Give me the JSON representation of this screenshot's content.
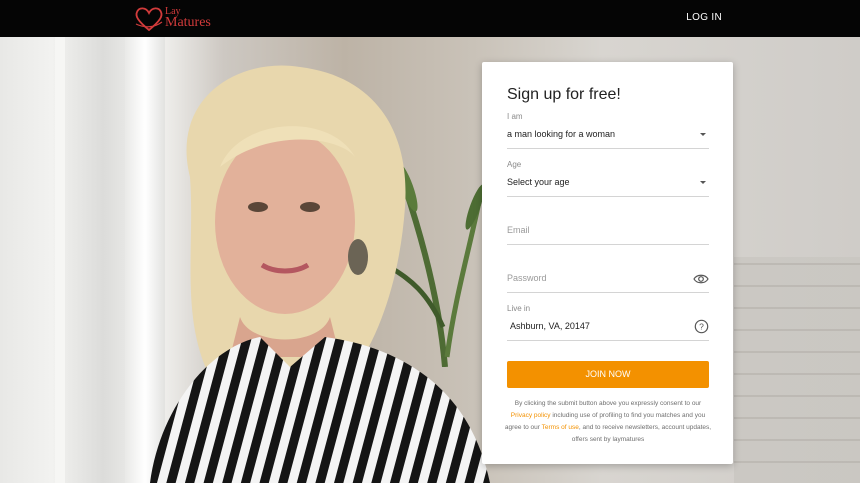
{
  "header": {
    "logo_top": "Lay",
    "logo_bottom": "Matures",
    "login_label": "LOG IN"
  },
  "signup": {
    "title": "Sign up for free!",
    "i_am": {
      "label": "I am",
      "value": "a man looking for a woman"
    },
    "age": {
      "label": "Age",
      "value": "Select your age"
    },
    "email": {
      "placeholder": "Email"
    },
    "password": {
      "placeholder": "Password"
    },
    "live_in": {
      "label": "Live in",
      "value": "Ashburn, VA, 20147"
    },
    "submit_label": "JOIN NOW",
    "legal": {
      "part1": "By clicking the submit button above you expressly consent to our ",
      "privacy_link": "Privacy policy",
      "part2": " including use of profiling to find you matches and you agree to our ",
      "terms_link": "Terms of use",
      "part3": ", and to receive newsletters, account updates, offers sent by laymatures"
    }
  },
  "colors": {
    "accent": "#f39100",
    "brand": "#d23b3b",
    "header_bg": "#050505"
  },
  "icons": [
    "heart-logo-icon",
    "caret-down-icon",
    "eye-icon",
    "help-icon"
  ]
}
